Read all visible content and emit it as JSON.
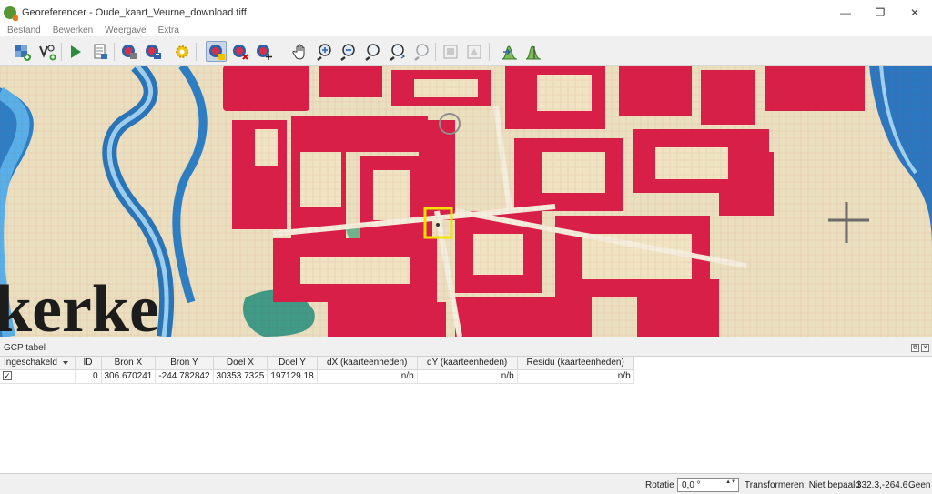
{
  "window": {
    "title": "Georeferencer - Oude_kaart_Veurne_download.tiff",
    "controls": {
      "minimize": "—",
      "maximize": "❐",
      "close": "✕"
    }
  },
  "menu": [
    "Bestand",
    "Bewerken",
    "Weergave",
    "Extra"
  ],
  "toolbar": {
    "buttons": [
      "open-raster-icon",
      "start-georeferencing-icon",
      "play-icon",
      "generate-script-icon",
      "load-gcp-icon",
      "save-gcp-icon",
      "settings-icon",
      "add-point-icon",
      "delete-point-icon",
      "move-point-icon",
      "pan-icon",
      "zoom-in-icon",
      "zoom-out-icon",
      "zoom-layer-icon",
      "zoom-last-icon",
      "zoom-next-icon",
      "link-georef-icon",
      "link-qgis-icon",
      "full-histogram-icon",
      "local-histogram-icon"
    ],
    "active_button": "add-point-icon"
  },
  "map": {
    "label": "kerke",
    "colors": {
      "parchment": "#eadfbf",
      "building": "#d81f48",
      "water": "#3a8fd0",
      "marker": "#f2e200"
    }
  },
  "gcp": {
    "title": "GCP tabel",
    "panel_buttons": [
      "⧉",
      "✕"
    ],
    "columns": [
      "Ingeschakeld",
      "ID",
      "Bron X",
      "Bron Y",
      "Doel X",
      "Doel Y",
      "dX (kaarteenheden)",
      "dY (kaarteenheden)",
      "Residu (kaarteenheden)"
    ],
    "rows": [
      {
        "enabled": "✓",
        "id": "0",
        "src_x": "306.670241",
        "src_y": "-244.782842",
        "dst_x": "30353.7325",
        "dst_y": "197129.18",
        "dx": "n/b",
        "dy": "n/b",
        "residual": "n/b"
      }
    ]
  },
  "status": {
    "rotation_label": "Rotatie",
    "rotation_value": "0,0 °",
    "spin_arrows": "▲▼",
    "transform": "Transformeren: Niet bepaald",
    "coords": "332.3,-264.6",
    "crs": "Geen"
  }
}
